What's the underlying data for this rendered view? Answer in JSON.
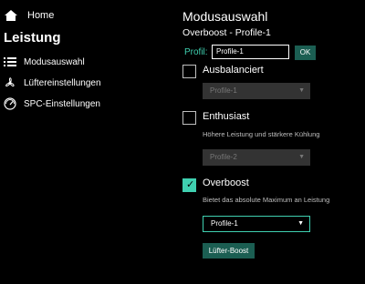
{
  "sidebar": {
    "home_label": "Home",
    "section_title": "Leistung",
    "items": [
      {
        "label": "Modusauswahl",
        "icon": "list-icon"
      },
      {
        "label": "Lüftereinstellungen",
        "icon": "fan-icon"
      },
      {
        "label": "SPC-Einstellungen",
        "icon": "gauge-icon"
      }
    ]
  },
  "main": {
    "title": "Modusauswahl",
    "subtitle": "Overboost - Profile-1",
    "profil_label": "Profil:",
    "profil_value": "Profile-1",
    "ok_label": "OK",
    "options": [
      {
        "label": "Ausbalanciert",
        "checked": false,
        "description": "",
        "select_value": "Profile-1",
        "select_enabled": false
      },
      {
        "label": "Enthusiast",
        "checked": false,
        "description": "Höhere Leistung und stärkere Kühlung",
        "select_value": "Profile-2",
        "select_enabled": false
      },
      {
        "label": "Overboost",
        "checked": true,
        "description": "Bietet das absolute Maximum an Leistung",
        "select_value": "Profile-1",
        "select_enabled": true
      }
    ],
    "fan_boost_label": "Lüfter-Boost"
  },
  "colors": {
    "accent": "#3fd0b0",
    "button_bg": "#1b5e52",
    "background": "#000000"
  }
}
